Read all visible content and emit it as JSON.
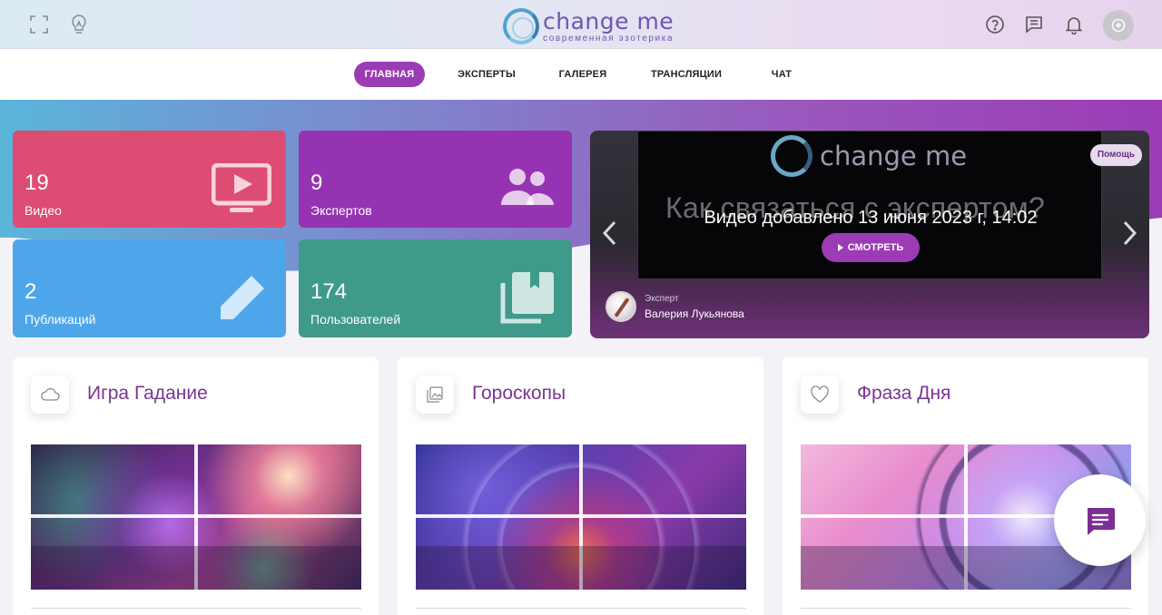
{
  "header": {
    "logo_title": "change me",
    "logo_subtitle": "современная эзотерика",
    "icons": [
      "fullscreen-icon",
      "lightbulb-icon",
      "help-icon",
      "messages-icon",
      "bell-icon",
      "add-account-icon"
    ]
  },
  "nav": {
    "items": [
      {
        "label": "ГЛАВНАЯ",
        "active": true
      },
      {
        "label": "ЭКСПЕРТЫ",
        "active": false
      },
      {
        "label": "ГАЛЕРЕЯ",
        "active": false
      },
      {
        "label": "ТРАНСЛЯЦИИ",
        "active": false
      },
      {
        "label": "ЧАТ",
        "active": false
      }
    ]
  },
  "stats": [
    {
      "value": "19",
      "label": "Видео",
      "color": "#dd4c72",
      "icon": "tv-play-icon"
    },
    {
      "value": "9",
      "label": "Экспертов",
      "color": "#9633b3",
      "icon": "users-icon"
    },
    {
      "value": "2",
      "label": "Публикаций",
      "color": "#4ea6ea",
      "icon": "pencil-icon"
    },
    {
      "value": "174",
      "label": "Пользователей",
      "color": "#3f9a8a",
      "icon": "library-icon"
    }
  ],
  "video": {
    "frame_logo": "change me",
    "frame_question": "Как связаться с экспертом?",
    "added_text": "Видео добавлено 13 июня 2023 г, 14:02",
    "watch_label": "СМОТРЕТЬ",
    "help_label": "Помощь",
    "expert_caption": "Эксперт",
    "expert_name": "Валерия Лукьянова"
  },
  "sections": [
    {
      "title": "Игра Гадание",
      "icon": "cloud-icon"
    },
    {
      "title": "Гороскопы",
      "icon": "gallery-icon"
    },
    {
      "title": "Фраза Дня",
      "icon": "heart-icon"
    }
  ],
  "colors": {
    "accent": "#9b3cb5",
    "title": "#7b3590"
  }
}
